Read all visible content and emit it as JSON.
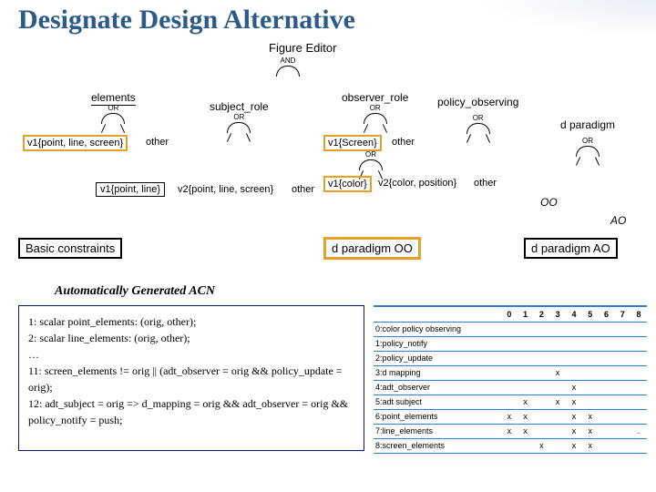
{
  "title": "Designate Design Alternative",
  "figure_editor": "Figure Editor",
  "and_label": "AND",
  "or_label": "OR",
  "level1": {
    "elements": "elements",
    "subject_role": "subject_role",
    "observer_role": "observer_role",
    "policy_observing": "policy_observing"
  },
  "leaves": {
    "v1_pls": "v1{point, line, screen}",
    "other": "other",
    "v1_pl": "v1{point, line}",
    "v2_pls": "v2{point, line, screen}",
    "v1_screen": "v1{Screen}",
    "v1_color": "v1{color}",
    "v2_cp": "v2{color, position}",
    "d_paradigm": "d  paradigm",
    "oo": "OO",
    "ao": "AO"
  },
  "bottom_boxes": {
    "basic_constraints": "Basic constraints",
    "d_paradigm_oo": "d  paradigm  OO",
    "d_paradigm_ao": "d  paradigm  AO"
  },
  "acn_title": "Automatically Generated ACN",
  "acn_lines": {
    "l1": "1: scalar point_elements: (orig, other);",
    "l2": "2: scalar line_elements: (orig, other);",
    "l3": "…",
    "l4": "11: screen_elements != orig || (adt_observer = orig && policy_update = orig);",
    "l5": "12: adt_subject = orig => d_mapping = orig && adt_observer = orig && policy_notify = push;"
  },
  "table": {
    "cols": [
      "0",
      "1",
      "2",
      "3",
      "4",
      "5",
      "6",
      "7",
      "8"
    ],
    "rows": [
      {
        "label": "0:color policy observing",
        "cells": [
          "",
          "",
          "",
          "",
          "",
          "",
          "",
          "",
          ""
        ]
      },
      {
        "label": "1:policy_notify",
        "cells": [
          "",
          "",
          "",
          "",
          "",
          "",
          "",
          "",
          ""
        ]
      },
      {
        "label": "2:policy_update",
        "cells": [
          "",
          "",
          "",
          "",
          "",
          "",
          "",
          "",
          ""
        ]
      },
      {
        "label": "3:d mapping",
        "cells": [
          "",
          "",
          "",
          "x",
          "",
          "",
          "",
          "",
          ""
        ]
      },
      {
        "label": "4:adt_observer",
        "cells": [
          "",
          "",
          "",
          "",
          "x",
          "",
          "",
          "",
          ""
        ]
      },
      {
        "label": "5:adt subject",
        "cells": [
          "",
          "x",
          "",
          "x",
          "x",
          "",
          "",
          "",
          ""
        ]
      },
      {
        "label": "6:point_elements",
        "cells": [
          "x",
          "x",
          "",
          "",
          "x",
          "x",
          "",
          "",
          ""
        ]
      },
      {
        "label": "7:line_elements",
        "cells": [
          "x",
          "x",
          "",
          "",
          "x",
          "x",
          "",
          "",
          "."
        ]
      },
      {
        "label": "8:screen_elements",
        "cells": [
          "",
          "",
          "x",
          "",
          "x",
          "x",
          "",
          "",
          ""
        ]
      }
    ]
  }
}
